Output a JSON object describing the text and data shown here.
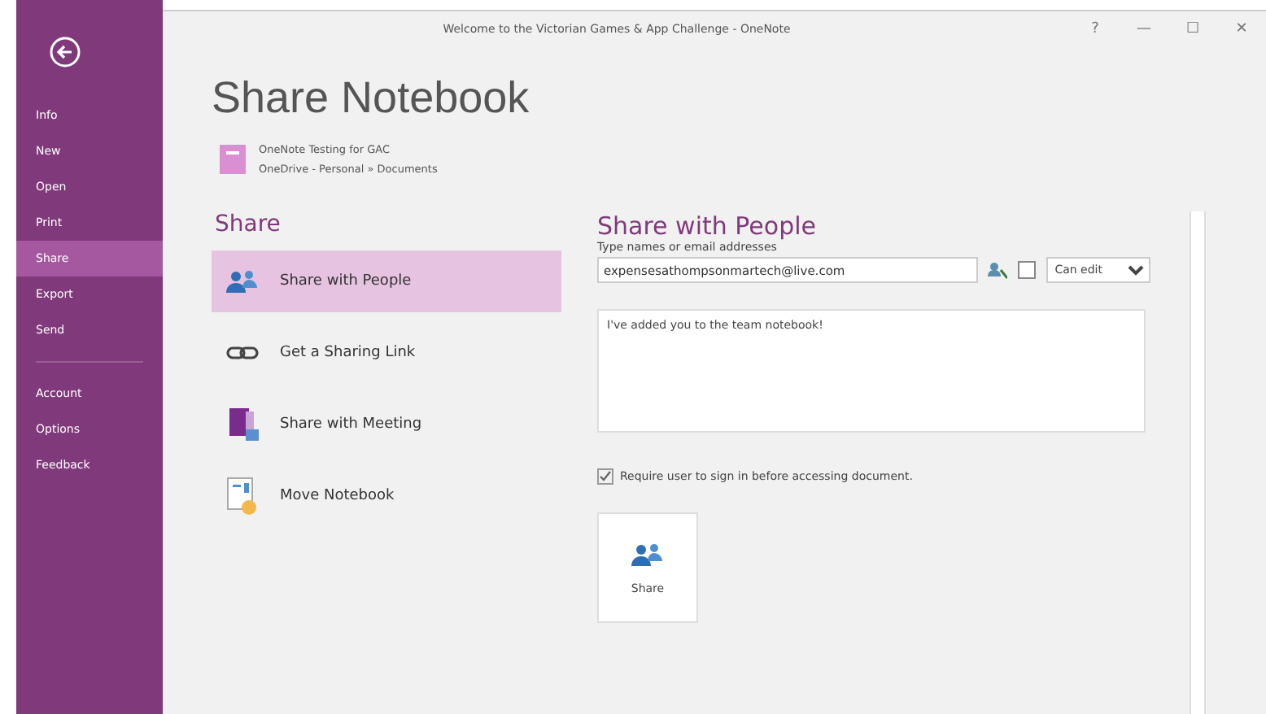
{
  "window": {
    "title": "Welcome to the Victorian Games & App Challenge - OneNote",
    "controls": [
      "?",
      "—",
      "☐",
      "✕"
    ]
  },
  "sidebar": {
    "groups": [
      [
        {
          "label": "Info",
          "selected": false
        },
        {
          "label": "New",
          "selected": false
        },
        {
          "label": "Open",
          "selected": false
        },
        {
          "label": "Print",
          "selected": false
        },
        {
          "label": "Share",
          "selected": true
        },
        {
          "label": "Export",
          "selected": false
        },
        {
          "label": "Send",
          "selected": false
        }
      ],
      [
        {
          "label": "Account",
          "selected": false
        },
        {
          "label": "Options",
          "selected": false
        },
        {
          "label": "Feedback",
          "selected": false
        }
      ]
    ]
  },
  "page": {
    "title": "Share Notebook",
    "notebook": {
      "name": "OneNote Testing for GAC",
      "location": "OneDrive - Personal » Documents"
    }
  },
  "share": {
    "heading": "Share",
    "options": [
      {
        "kind": "people",
        "label": "Share with People",
        "selected": true
      },
      {
        "kind": "link",
        "label": "Get a Sharing Link",
        "selected": false
      },
      {
        "kind": "meeting",
        "label": "Share with Meeting",
        "selected": false
      },
      {
        "kind": "move",
        "label": "Move Notebook",
        "selected": false
      }
    ]
  },
  "share_with_people": {
    "heading": "Share with People",
    "field_label": "Type names or email addresses",
    "value": "expensesathompsonmartech@live.com",
    "permission": "Can edit",
    "message": "I've added you to the team notebook!",
    "require_signin": {
      "label": "Require user to sign in before accessing document.",
      "checked": true
    },
    "share_button": "Share"
  }
}
